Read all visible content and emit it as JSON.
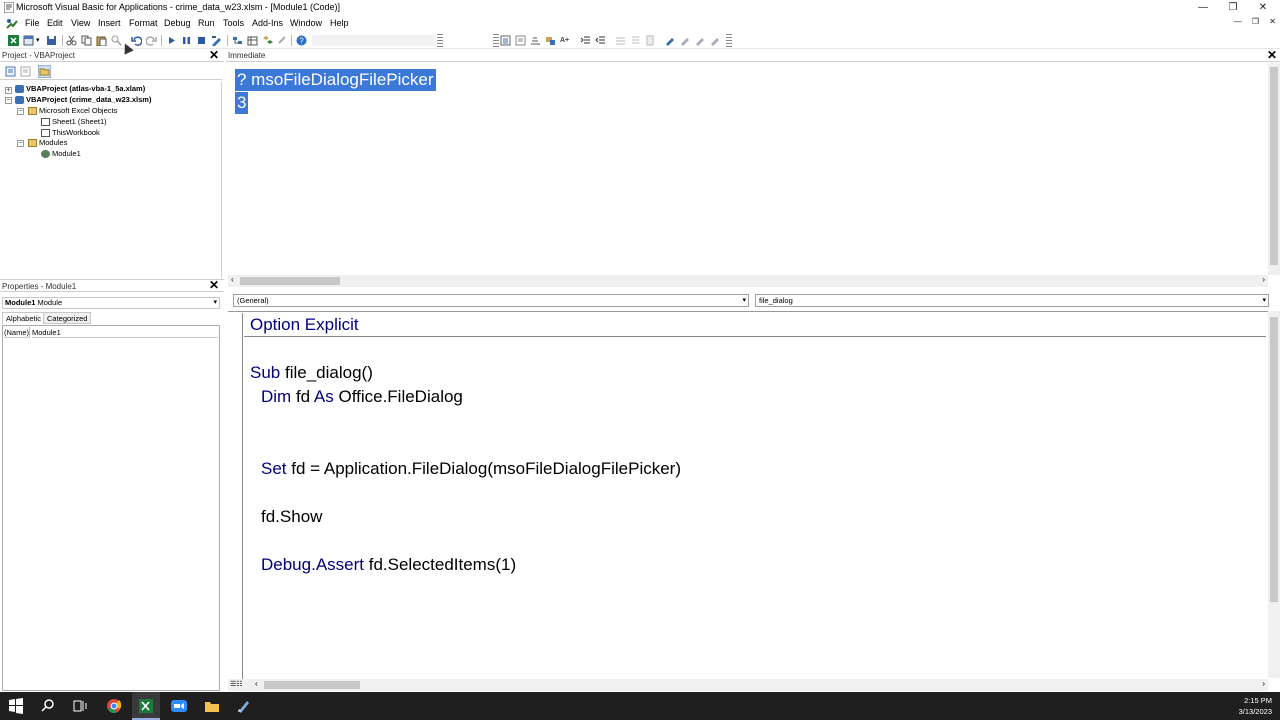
{
  "window": {
    "title": "Microsoft Visual Basic for Applications - crime_data_w23.xlsm - [Module1 (Code)]",
    "controls": [
      "—",
      "❐",
      "✕"
    ],
    "mdi_controls": [
      "—",
      "❐",
      "✕"
    ]
  },
  "menu": [
    "File",
    "Edit",
    "View",
    "Insert",
    "Format",
    "Debug",
    "Run",
    "Tools",
    "Add-Ins",
    "Window",
    "Help"
  ],
  "project": {
    "header": "Project - VBAProject",
    "tree": {
      "p1": "VBAProject (atlas-vba-1_5a.xlam)",
      "p2": "VBAProject (crime_data_w23.xlsm)",
      "excel_objects": "Microsoft Excel Objects",
      "sheet1": "Sheet1 (Sheet1)",
      "thisworkbook": "ThisWorkbook",
      "modules": "Modules",
      "module1": "Module1"
    }
  },
  "properties": {
    "header": "Properties - Module1",
    "object_name": "Module1",
    "object_type": "Module",
    "tab_alpha": "Alphabetic",
    "tab_cat": "Categorized",
    "row_name": "(Name)",
    "row_value": "Module1"
  },
  "immediate": {
    "header": "Immediate",
    "line1": "? msoFileDialogFilePicker",
    "line2": "3"
  },
  "code": {
    "object_combo": "(General)",
    "proc_combo": "file_dialog",
    "l1_kw": "Option Explicit",
    "l3_kw": "Sub",
    "l3_rest": " file_dialog()",
    "l4_kw1": "Dim",
    "l4_mid": " fd ",
    "l4_kw2": "As",
    "l4_rest": " Office.FileDialog",
    "l7_kw": "Set",
    "l7_rest": " fd = Application.FileDialog(msoFileDialogFilePicker)",
    "l9": "fd.Show",
    "l11_kw": "Debug.Assert",
    "l11_rest": " fd.SelectedItems(1)"
  },
  "taskbar": {
    "time": "2:15 PM",
    "date": "3/13/2023",
    "icons": [
      "windows-start-icon",
      "search-icon",
      "task-view-icon",
      "chrome-icon",
      "excel-icon",
      "zoom-icon",
      "file-explorer-icon",
      "vba-editor-icon"
    ]
  },
  "colors": {
    "keyword": "#00007f",
    "selection": "#3b78d8",
    "taskbar": "#1f1f1f"
  }
}
